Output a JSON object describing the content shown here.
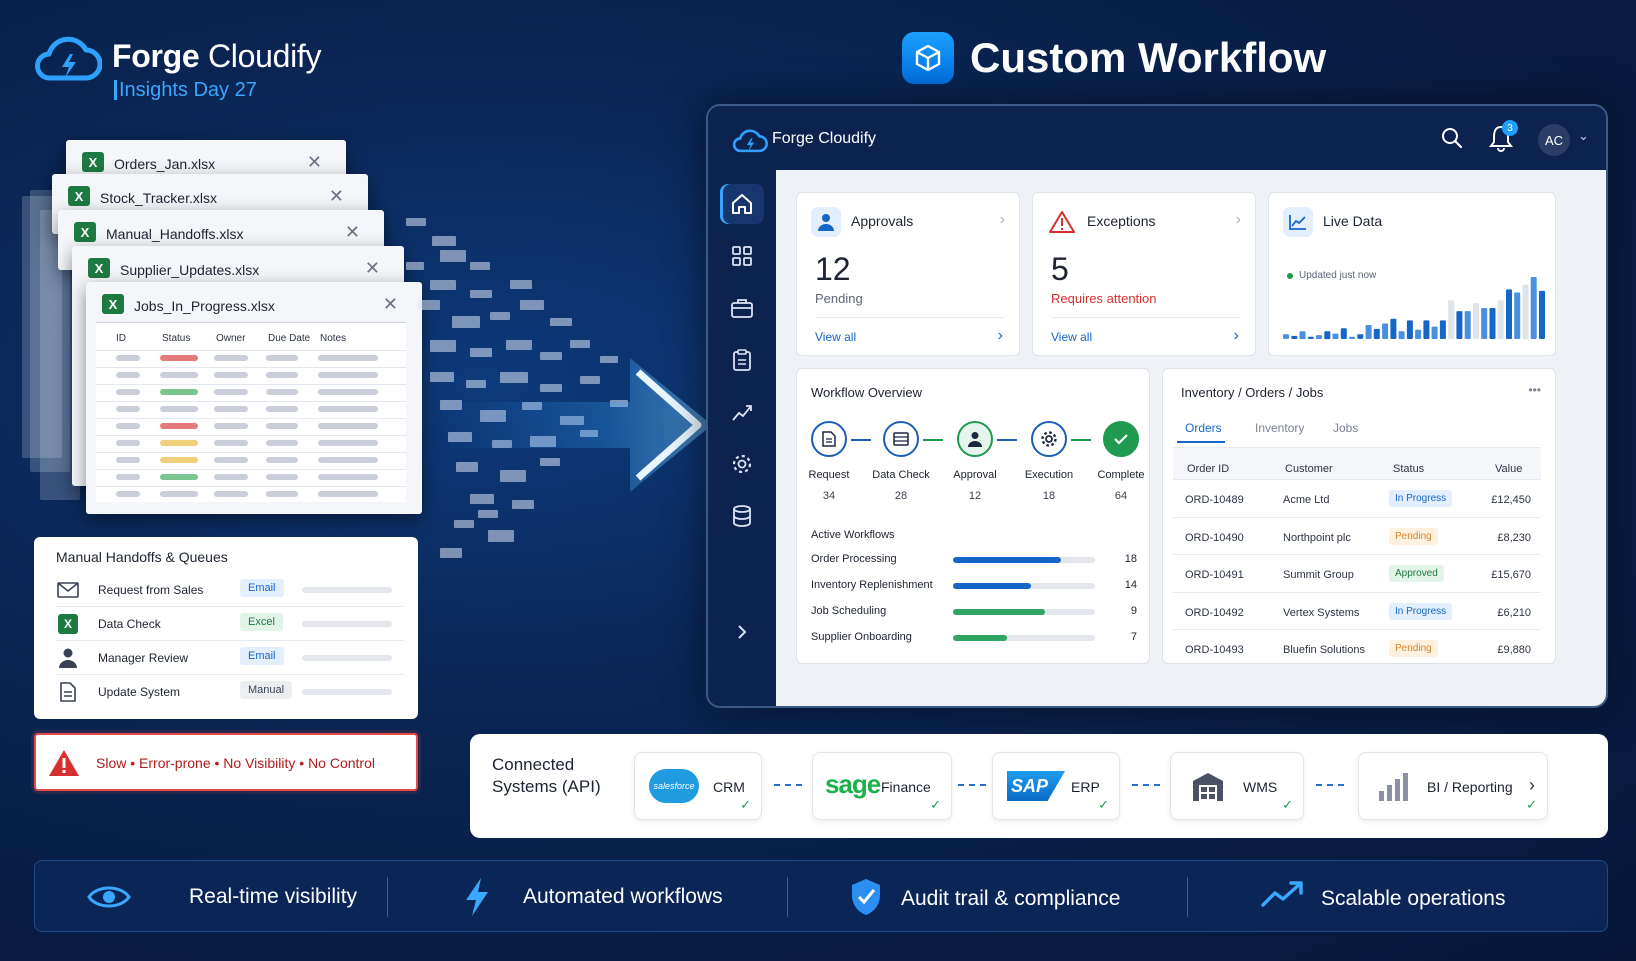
{
  "brand": {
    "name_bold": "Forge",
    "name_rest": " Cloudify",
    "subtitle": "Insights Day 27"
  },
  "headline": {
    "text": "Custom Workflow"
  },
  "spreadsheets": [
    {
      "name": "Orders_Jan.xlsx"
    },
    {
      "name": "Stock_Tracker.xlsx"
    },
    {
      "name": "Manual_Handoffs.xlsx"
    },
    {
      "name": "Supplier_Updates.xlsx"
    },
    {
      "name": "Jobs_In_Progress.xlsx"
    }
  ],
  "sheet_columns": [
    "ID",
    "Status",
    "Owner",
    "Due Date",
    "Notes"
  ],
  "sheet_close": "✕",
  "handoffs": {
    "title": "Manual Handoffs & Queues",
    "rows": [
      {
        "label": "Request from Sales",
        "tag": "Email",
        "icon": "envelope-icon"
      },
      {
        "label": "Data Check",
        "tag": "Excel",
        "icon": "excel-icon"
      },
      {
        "label": "Manager Review",
        "tag": "Email",
        "icon": "person-icon"
      },
      {
        "label": "Update System",
        "tag": "Manual",
        "icon": "document-icon"
      }
    ]
  },
  "warning": {
    "text": "Slow • Error-prone • No Visibility • No Control"
  },
  "app": {
    "name": "Forge Cloudify",
    "notifications": "3",
    "avatar": "AC",
    "caret": "⌄",
    "nav": [
      "home-icon",
      "grid-icon",
      "briefcase-icon",
      "clipboard-icon",
      "analytics-icon",
      "settings-icon",
      "database-icon",
      "expand-chevron-icon"
    ],
    "kpis": [
      {
        "title": "Approvals",
        "value": "12",
        "sub": "Pending",
        "link": "View all"
      },
      {
        "title": "Exceptions",
        "value": "5",
        "sub": "Requires attention",
        "link": "View all"
      },
      {
        "title": "Live Data",
        "status": "Updated just now"
      }
    ],
    "chevron": "›",
    "live_chart": [
      6,
      4,
      10,
      3,
      5,
      10,
      7,
      14,
      3,
      6,
      18,
      13,
      20,
      26,
      10,
      24,
      12,
      24,
      16,
      24,
      50,
      36,
      36,
      46,
      40,
      40,
      50,
      64,
      60,
      70,
      80,
      62
    ],
    "workflow": {
      "title": "Workflow Overview",
      "steps": [
        {
          "label": "Request",
          "value": "34"
        },
        {
          "label": "Data Check",
          "value": "28"
        },
        {
          "label": "Approval",
          "value": "12"
        },
        {
          "label": "Execution",
          "value": "18"
        },
        {
          "label": "Complete",
          "value": "64"
        }
      ],
      "active_title": "Active Workflows",
      "active": [
        {
          "label": "Order Processing",
          "value": "18",
          "fill": 0.76
        },
        {
          "label": "Inventory Replenishment",
          "value": "14",
          "fill": 0.55
        },
        {
          "label": "Job Scheduling",
          "value": "9",
          "fill": 0.65
        },
        {
          "label": "Supplier Onboarding",
          "value": "7",
          "fill": 0.38
        }
      ]
    },
    "inventory": {
      "title": "Inventory / Orders / Jobs",
      "more": "•••",
      "tabs": [
        "Orders",
        "Inventory",
        "Jobs"
      ],
      "columns": [
        "Order ID",
        "Customer",
        "Status",
        "Value"
      ],
      "rows": [
        {
          "id": "ORD-10489",
          "customer": "Acme Ltd",
          "status": "In Progress",
          "value": "£12,450"
        },
        {
          "id": "ORD-10490",
          "customer": "Northpoint plc",
          "status": "Pending",
          "value": "£8,230"
        },
        {
          "id": "ORD-10491",
          "customer": "Summit Group",
          "status": "Approved",
          "value": "£15,670"
        },
        {
          "id": "ORD-10492",
          "customer": "Vertex Systems",
          "status": "In Progress",
          "value": "£6,210"
        },
        {
          "id": "ORD-10493",
          "customer": "Bluefin Solutions",
          "status": "Pending",
          "value": "£9,880"
        }
      ]
    }
  },
  "systems": {
    "title": "Connected Systems (API)",
    "items": [
      {
        "logo": "salesforce",
        "label": "CRM"
      },
      {
        "logo": "sage",
        "label": "Finance"
      },
      {
        "logo": "SAP",
        "label": "ERP"
      },
      {
        "logo": "warehouse-icon",
        "label": "WMS"
      },
      {
        "logo": "bar-chart-icon",
        "label": "BI / Reporting"
      }
    ],
    "check": "✓"
  },
  "features": [
    {
      "label": "Real-time visibility",
      "icon": "eye-icon"
    },
    {
      "label": "Automated workflows",
      "icon": "lightning-icon"
    },
    {
      "label": "Audit trail & compliance",
      "icon": "shield-check-icon"
    },
    {
      "label": "Scalable operations",
      "icon": "trending-up-icon"
    }
  ],
  "colors": {
    "accent": "#1da0ff",
    "danger": "#e34b4b",
    "success": "#1f9a4e",
    "navy": "#0e2550"
  }
}
